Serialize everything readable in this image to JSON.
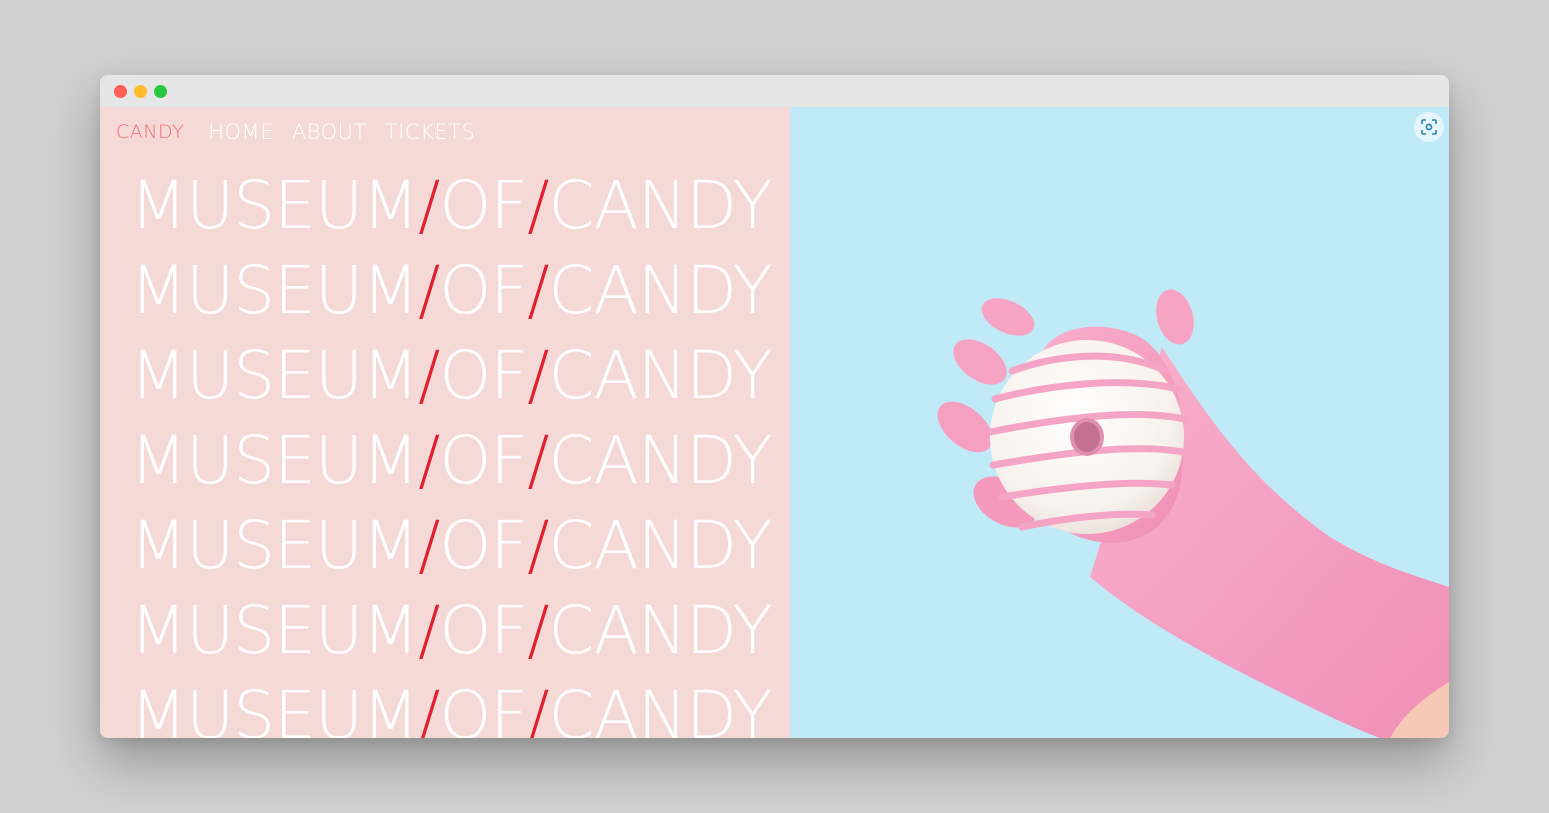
{
  "window": {
    "controls": [
      "close",
      "minimize",
      "zoom"
    ]
  },
  "nav": {
    "brand": "CANDY",
    "links": [
      "HOME",
      "ABOUT",
      "TICKETS"
    ]
  },
  "hero": {
    "word1": "MUSEUM",
    "word2": "OF",
    "word3": "CANDY",
    "separator": "/",
    "repeat_count": 7
  },
  "image": {
    "subject": "pink-gloved hand holding glazed donut",
    "icon": "screenshot-scan-icon"
  },
  "colors": {
    "left_bg": "#f5d9d6",
    "right_bg": "#c0eaf8",
    "brand_text": "#ef6f78",
    "slash_accent": "#e0202f",
    "glove_pink": "#f7a3c3",
    "donut_white": "#fbf7f3",
    "drizzle_pink": "#f4a5c5"
  }
}
